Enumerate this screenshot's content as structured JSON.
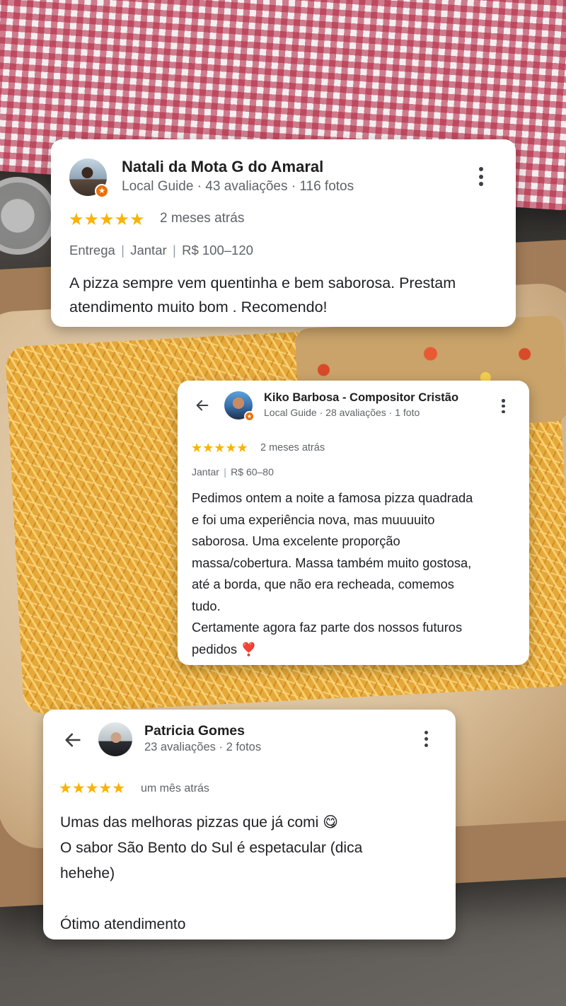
{
  "background": {
    "description_icon": "pizza-photo"
  },
  "colors": {
    "star": "#f9b300",
    "local_guide_badge": "#e8710a",
    "card_bg": "#ffffff",
    "meta_text": "#5f6368"
  },
  "reviews": [
    {
      "name": "Natali da Mota G do Amaral",
      "meta": "Local Guide · 43 avaliações · 116 fotos",
      "stars": "★★★★★",
      "rating": 5,
      "when": "2 meses atrás",
      "tags": [
        "Entrega",
        "Jantar",
        "R$ 100–120"
      ],
      "text_lines": [
        "A pizza sempre vem quentinha e bem saborosa. Prestam",
        "atendimento muito bom . Recomendo!"
      ]
    },
    {
      "name": "Kiko Barbosa - Compositor Cristão",
      "meta": "Local Guide · 28 avaliações · 1 foto",
      "stars": "★★★★★",
      "rating": 5,
      "when": "2 meses atrás",
      "tags": [
        "Jantar",
        "R$ 60–80"
      ],
      "text_lines": [
        "Pedimos ontem a noite a famosa pizza quadrada",
        "e foi uma experiência nova, mas muuuuito",
        "saborosa. Uma excelente proporção",
        "massa/cobertura. Massa também muito gostosa,",
        "até a borda, que não era recheada, comemos",
        "tudo.",
        "Certamente agora faz parte dos nossos futuros",
        "pedidos ❣️"
      ]
    },
    {
      "name": "Patricia Gomes",
      "meta": "23 avaliações · 2 fotos",
      "stars": "★★★★★",
      "rating": 5,
      "when": "um mês atrás",
      "text_lines": [
        "Umas das melhoras pizzas que já comi 😋",
        "O sabor São Bento do Sul é espetacular (dica",
        "hehehe)",
        "",
        "Ótimo atendimento"
      ]
    }
  ],
  "icons": {
    "more": "more-vert-icon",
    "back": "arrow-back-icon",
    "guide_badge": "local-guide-star-icon"
  }
}
